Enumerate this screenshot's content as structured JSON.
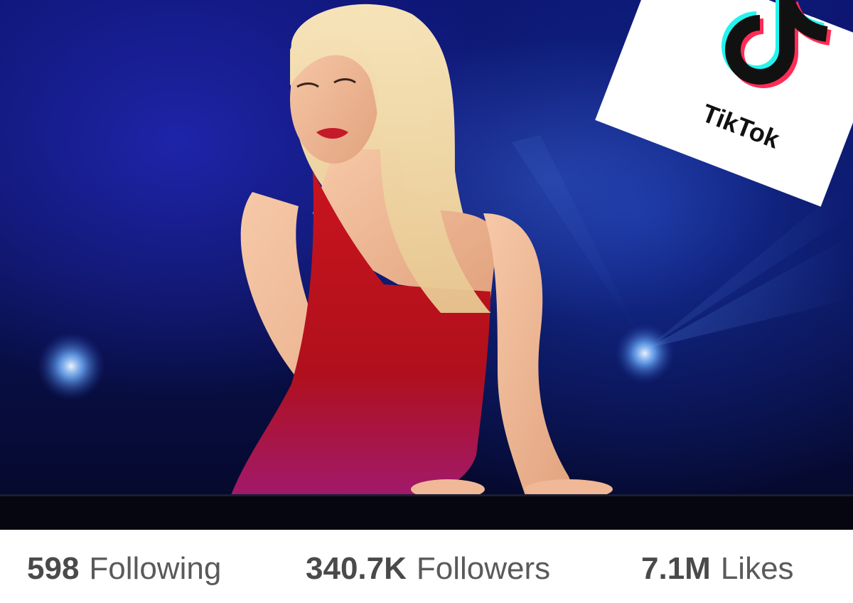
{
  "brand": {
    "wordmark": "TikTok",
    "icon": "tiktok-note-icon",
    "colors": {
      "cyan": "#25F4EE",
      "red": "#FE2C55",
      "black": "#111111"
    }
  },
  "photo": {
    "subject_icon": "performer-photo"
  },
  "stats": {
    "following": {
      "value": "598",
      "label": "Following"
    },
    "followers": {
      "value": "340.7K",
      "label": "Followers"
    },
    "likes": {
      "value": "7.1M",
      "label": "Likes"
    }
  }
}
